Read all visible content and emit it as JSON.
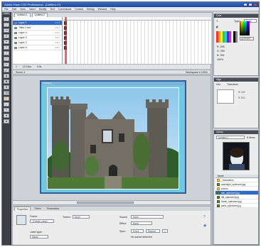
{
  "app": {
    "title": "Adobe Flash CS3 Professional - [Untitled-1*]",
    "colors": {
      "titlebar": "#2a56b0",
      "toolbox": "#3d3f44",
      "stage": "#6fc8e0",
      "selection": "#316ac5"
    }
  },
  "menu": [
    "File",
    "Edit",
    "View",
    "Insert",
    "Modify",
    "Text",
    "Commands",
    "Control",
    "Debug",
    "Window",
    "Help"
  ],
  "toolbox": {
    "title": "Tools",
    "tools": [
      "selection-tool",
      "subselection-tool",
      "free-transform-tool",
      "lasso-tool",
      "pen-tool",
      "text-tool",
      "line-tool",
      "rectangle-tool",
      "pencil-tool",
      "brush-tool",
      "ink-bottle-tool",
      "paint-bucket-tool",
      "eyedropper-tool",
      "eraser-tool",
      "hand-tool",
      "zoom-tool",
      "stroke-color",
      "fill-color",
      "swap-colors"
    ]
  },
  "timeline": {
    "tabs": [
      "Untitled-1",
      "Untitled-2"
    ],
    "layers": [
      {
        "name": "Layer 1",
        "selected": true
      },
      {
        "name": "Titles Color",
        "selected": false
      },
      {
        "name": "Layer 4",
        "selected": false
      },
      {
        "name": "Layer 3",
        "selected": false
      },
      {
        "name": "Layer 2",
        "selected": false
      },
      {
        "name": "Layer 6",
        "selected": false
      }
    ],
    "status": [
      "1",
      "12.0 fps",
      "0.0s"
    ]
  },
  "editbar": {
    "scene": "Scene 1",
    "workspace": "Workspace ▾",
    "zoom": "100%"
  },
  "stage": {
    "label": "Untitled-1"
  },
  "properties": {
    "tabs": [
      "Properties",
      "Filters",
      "Parameters"
    ],
    "active_tab": "Properties",
    "frame_label": "Frame",
    "frame_placeholder": "<Frame Label>",
    "label_type_label": "Label type:",
    "label_type_value": "Name",
    "tween_label": "Tween:",
    "tween_value": "None",
    "sound_label": "Sound:",
    "sound_value": "None",
    "effect_label": "Effect:",
    "effect_value": "None",
    "sync_label": "Sync:",
    "sync_value": "Event",
    "repeat_value": "Repeat",
    "repeat_count": "1",
    "no_sound": "No sound selected"
  },
  "panels": {
    "color": {
      "title": "Color",
      "type_label": "Type:",
      "type_value": "Solid",
      "r": "R: 255",
      "g": "G: 255",
      "b": "B: 255",
      "hex": "#FFFFFF",
      "alpha": "100%"
    },
    "align": {
      "title": "Align",
      "tabs": [
        "Info",
        "Transform"
      ],
      "x": "X: 0.0",
      "y": "Y: 0.0"
    },
    "library": {
      "title": "Library",
      "document": "Untitled-1",
      "count": "9 items",
      "header": "Name",
      "items": [
        {
          "name": "_Animations",
          "type": "folder"
        },
        {
          "name": "waterlight_optimized.jpg",
          "type": "bitmap"
        },
        {
          "name": "photos",
          "type": "folder"
        },
        {
          "name": "abc_optimized.jpg",
          "type": "bitmap",
          "selected": true
        },
        {
          "name": "diff_optimized.jpg",
          "type": "bitmap"
        },
        {
          "name": "frame_optimized.jpg",
          "type": "bitmap"
        },
        {
          "name": "parts_optimized.jpg",
          "type": "bitmap"
        }
      ]
    }
  }
}
